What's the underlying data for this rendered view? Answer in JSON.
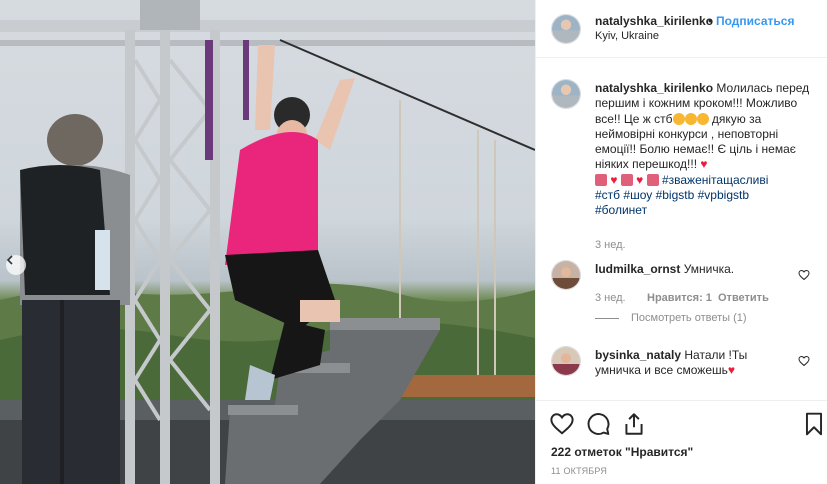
{
  "post": {
    "username": "natalyshka_kirilenko",
    "separator": "•",
    "follow_label": "Подписаться",
    "location": "Kyiv, Ukraine"
  },
  "caption": {
    "username": "natalyshka_kirilenko",
    "text_1": " Молилась перед першим і кожним кроком!!! Можливо все!! Це ж стб",
    "text_2": " дякую за неймовірні конкурси , неповторні емоції!! Болю немає!! Є ціль і немає ніяких перешкод!!! ",
    "hashtags": [
      "#зваженітащасливі",
      "#стб",
      "#шоу",
      "#bigstb",
      "#vpbigstb",
      "#болинет"
    ],
    "time": "3 нед."
  },
  "comments": [
    {
      "username": "ludmilka_ornst",
      "text": " Умничка.",
      "time": "3 нед.",
      "likes": "Нравится: 1",
      "reply_label": "Ответить",
      "view_replies": "Посмотреть ответы (1)"
    },
    {
      "username": "bysinka_nataly",
      "text": " Натали !Ты умничка и все сможешь"
    }
  ],
  "likes_count": "222 отметок \"Нравится\"",
  "date": "11 октября",
  "icons": {
    "like": "heart-outline-icon",
    "comment": "speech-bubble-icon",
    "share": "share-icon",
    "save": "bookmark-icon",
    "small_like": "heart-small-icon"
  },
  "colors": {
    "link": "#3897f0",
    "hashtag": "#003569",
    "meta": "#8e8e8e",
    "emoji_heart": "#ed1c3c"
  }
}
